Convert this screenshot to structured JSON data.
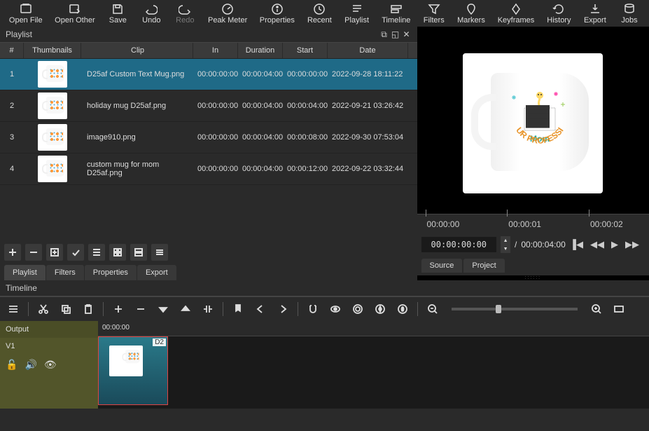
{
  "toolbar": {
    "open_file": "Open File",
    "open_other": "Open Other",
    "save": "Save",
    "undo": "Undo",
    "redo": "Redo",
    "peak_meter": "Peak Meter",
    "properties": "Properties",
    "recent": "Recent",
    "playlist": "Playlist",
    "timeline": "Timeline",
    "filters": "Filters",
    "markers": "Markers",
    "keyframes": "Keyframes",
    "history": "History",
    "export": "Export",
    "jobs": "Jobs"
  },
  "playlist": {
    "title": "Playlist",
    "headers": {
      "num": "#",
      "thumb": "Thumbnails",
      "clip": "Clip",
      "in": "In",
      "dur": "Duration",
      "start": "Start",
      "date": "Date"
    },
    "rows": [
      {
        "num": "1",
        "clip": "D25af Custom Text Mug.png",
        "in": "00:00:00:00",
        "dur": "00:00:04:00",
        "start": "00:00:00:00",
        "date": "2022-09-28 18:11:22"
      },
      {
        "num": "2",
        "clip": "holiday mug D25af.png",
        "in": "00:00:00:00",
        "dur": "00:00:04:00",
        "start": "00:00:04:00",
        "date": "2022-09-21 03:26:42"
      },
      {
        "num": "3",
        "clip": "image910.png",
        "in": "00:00:00:00",
        "dur": "00:00:04:00",
        "start": "00:00:08:00",
        "date": "2022-09-30 07:53:04"
      },
      {
        "num": "4",
        "clip": "custom mug for mom D25af.png",
        "in": "00:00:00:00",
        "dur": "00:00:04:00",
        "start": "00:00:12:00",
        "date": "2022-09-22 03:32:44"
      }
    ]
  },
  "bottom_tabs": {
    "playlist": "Playlist",
    "filters": "Filters",
    "properties": "Properties",
    "export": "Export"
  },
  "preview": {
    "ruler": {
      "t0": "00:00:00",
      "t1": "00:00:01",
      "t2": "00:00:02"
    },
    "time_current": "00:00:00:00",
    "time_sep": "/",
    "time_total": "00:00:04:00",
    "source_tab": "Source",
    "project_tab": "Project",
    "mug_text1": "Mom",
    "mug_text2": "OUR PROFESSIO"
  },
  "timeline": {
    "title": "Timeline",
    "output": "Output",
    "v1": "V1",
    "ruler": "00:00:00",
    "clip_label": "D2"
  }
}
